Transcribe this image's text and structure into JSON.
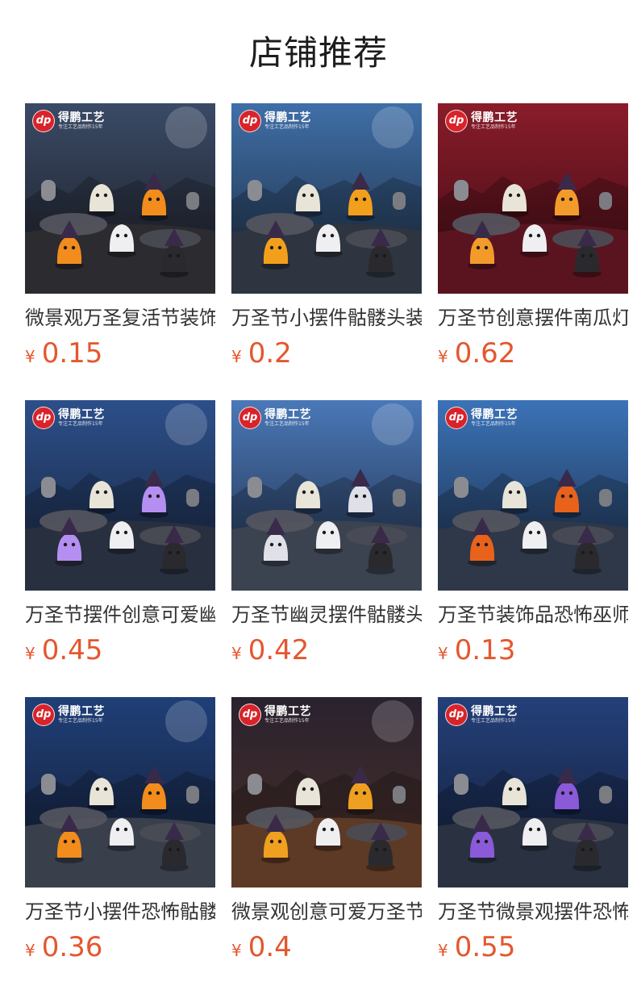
{
  "page": {
    "title": "店铺推荐"
  },
  "brand": {
    "badge": "dp",
    "name": "得鹏工艺",
    "slogan": "专注工艺品制作15年"
  },
  "currency_symbol": "¥",
  "colors": {
    "price": "#e4572e",
    "brand_red": "#d8232a"
  },
  "products": [
    {
      "title": "微景观万圣复活节装饰",
      "price": "0.15",
      "scene": "night-graveyard-dark",
      "bg_top": "#3a4a66",
      "bg_bottom": "#1c1c22",
      "ground": "#2b2b30",
      "accent": "#f28c1c"
    },
    {
      "title": "万圣节小摆件骷髅头装饰",
      "price": "0.2",
      "scene": "blue-graveyard",
      "bg_top": "#3f6fa8",
      "bg_bottom": "#1d2a3c",
      "ground": "#2e3540",
      "accent": "#f2a01c"
    },
    {
      "title": "万圣节创意摆件南瓜灯",
      "price": "0.62",
      "scene": "red-stage",
      "bg_top": "#8a1c2a",
      "bg_bottom": "#3a0c14",
      "ground": "#5a1420",
      "accent": "#f39b2a"
    },
    {
      "title": "万圣节摆件创意可爱幽灵",
      "price": "0.45",
      "scene": "moonlit-ghosts",
      "bg_top": "#2c4f8a",
      "bg_bottom": "#18233a",
      "ground": "#283040",
      "accent": "#b58ef2"
    },
    {
      "title": "万圣节幽灵摆件骷髅头",
      "price": "0.42",
      "scene": "blue-rocks",
      "bg_top": "#4a78b8",
      "bg_bottom": "#1f2c44",
      "ground": "#3b4250",
      "accent": "#e0e0e8"
    },
    {
      "title": "万圣节装饰品恐怖巫师帽",
      "price": "0.13",
      "scene": "blue-hill",
      "bg_top": "#3b73b8",
      "bg_bottom": "#1b2a42",
      "ground": "#2f3848",
      "accent": "#e8621c"
    },
    {
      "title": "万圣节小摆件恐怖骷髅头",
      "price": "0.36",
      "scene": "castle-night",
      "bg_top": "#1f3f78",
      "bg_bottom": "#141c30",
      "ground": "#3a3f4c",
      "accent": "#f28c1c"
    },
    {
      "title": "微景观创意可爱万圣节",
      "price": "0.4",
      "scene": "wood-deck",
      "bg_top": "#2a2230",
      "bg_bottom": "#4a3024",
      "ground": "#5c3a26",
      "accent": "#f0a020"
    },
    {
      "title": "万圣节微景观摆件恐怖树",
      "price": "0.55",
      "scene": "haunted-house",
      "bg_top": "#24407a",
      "bg_bottom": "#131c34",
      "ground": "#2a3242",
      "accent": "#8a5ad8"
    }
  ]
}
